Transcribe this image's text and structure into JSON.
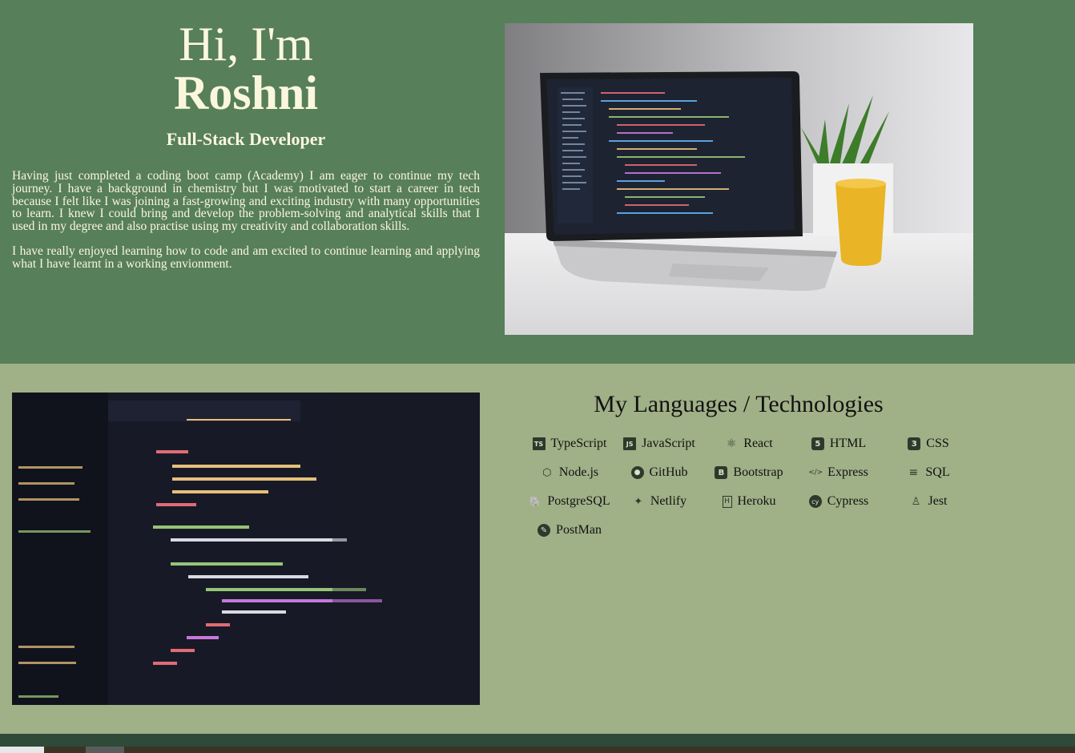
{
  "hero": {
    "greeting": "Hi, I'm",
    "name": "Roshni",
    "role": "Full-Stack Developer",
    "bio": [
      "Having just completed a coding boot camp (Academy) I am eager to continue my tech journey. I have a background in chemistry but I was motivated to start a career in tech because I felt like I was joining a fast-growing and exciting industry with many opportunities to learn. I knew I could bring and develop the problem-solving and analytical skills that I used in my degree and also practise using my creativity and collaboration skills.",
      "I have really enjoyed learning how to code and am excited to continue learning and applying what I have learnt in a working envionment."
    ]
  },
  "skills": {
    "title": "My Languages / Technologies",
    "items": [
      {
        "label": "TypeScript",
        "icon": "typescript-icon",
        "glyph": "TS"
      },
      {
        "label": "JavaScript",
        "icon": "javascript-icon",
        "glyph": "JS"
      },
      {
        "label": "React",
        "icon": "react-icon",
        "glyph": "⚛"
      },
      {
        "label": "HTML",
        "icon": "html5-icon",
        "glyph": "5"
      },
      {
        "label": "CSS",
        "icon": "css3-icon",
        "glyph": "3"
      },
      {
        "label": "Node.js",
        "icon": "nodejs-icon",
        "glyph": "⬡"
      },
      {
        "label": "GitHub",
        "icon": "github-icon",
        "glyph": "●"
      },
      {
        "label": "Bootstrap",
        "icon": "bootstrap-icon",
        "glyph": "B"
      },
      {
        "label": "Express",
        "icon": "express-icon",
        "glyph": "</>"
      },
      {
        "label": "SQL",
        "icon": "database-icon",
        "glyph": "≡"
      },
      {
        "label": "PostgreSQL",
        "icon": "postgresql-icon",
        "glyph": "🐘"
      },
      {
        "label": "Netlify",
        "icon": "netlify-icon",
        "glyph": "✦"
      },
      {
        "label": "Heroku",
        "icon": "heroku-icon",
        "glyph": "H"
      },
      {
        "label": "Cypress",
        "icon": "cypress-icon",
        "glyph": "cy"
      },
      {
        "label": "Jest",
        "icon": "jest-icon",
        "glyph": "♙"
      },
      {
        "label": "PostMan",
        "icon": "postman-icon",
        "glyph": "✎"
      }
    ]
  },
  "colors": {
    "hero_bg": "#577f59",
    "skills_bg": "#a0b087",
    "hero_text": "#fbf7dd",
    "footer": "#2f4a38"
  }
}
